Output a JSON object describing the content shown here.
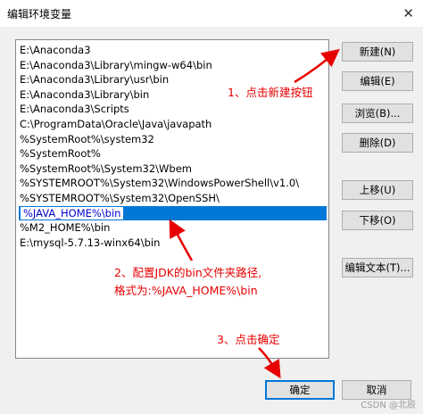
{
  "window": {
    "title": "编辑环境变量",
    "close_glyph": "✕"
  },
  "paths": [
    "E:\\Anaconda3",
    "E:\\Anaconda3\\Library\\mingw-w64\\bin",
    "E:\\Anaconda3\\Library\\usr\\bin",
    "E:\\Anaconda3\\Library\\bin",
    "E:\\Anaconda3\\Scripts",
    "C:\\ProgramData\\Oracle\\Java\\javapath",
    "%SystemRoot%\\system32",
    "%SystemRoot%",
    "%SystemRoot%\\System32\\Wbem",
    "%SYSTEMROOT%\\System32\\WindowsPowerShell\\v1.0\\",
    "%SYSTEMROOT%\\System32\\OpenSSH\\",
    "%JAVA_HOME%\\bin",
    "%M2_HOME%\\bin",
    "E:\\mysql-5.7.13-winx64\\bin"
  ],
  "selected_index": 11,
  "buttons": {
    "new": "新建(N)",
    "edit": "编辑(E)",
    "browse": "浏览(B)...",
    "delete": "删除(D)",
    "move_up": "上移(U)",
    "move_down": "下移(O)",
    "edit_text": "编辑文本(T)...",
    "ok": "确定",
    "cancel": "取消"
  },
  "annotations": {
    "step1": "1、点击新建按钮",
    "step2_line1": "2、配置JDK的bin文件夹路径,",
    "step2_line2": "格式为:%JAVA_HOME%\\bin",
    "step3": "3、点击确定"
  },
  "watermark": "CSDN @北辰",
  "colors": {
    "selection": "#0078d7",
    "annotation": "#e60000",
    "dialog_bg": "#f0f0f0",
    "button_bg": "#e1e1e1"
  }
}
